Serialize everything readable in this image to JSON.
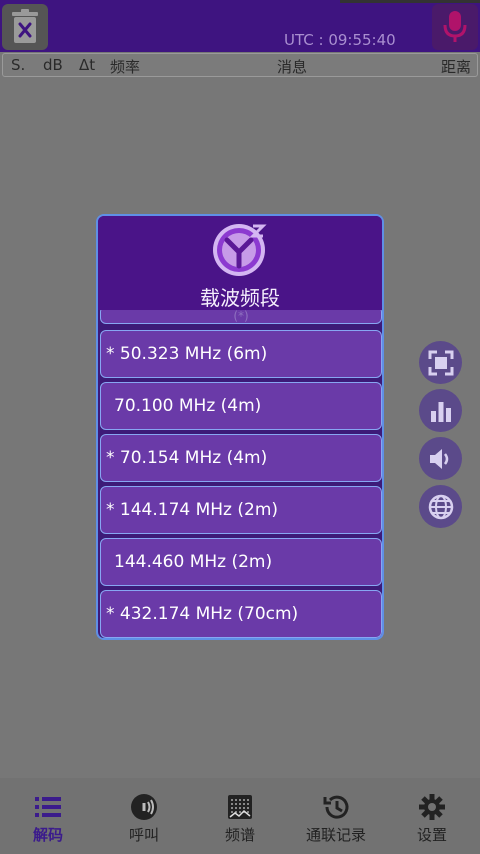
{
  "header": {
    "utc_text": "UTC : 09:55:40"
  },
  "columns": [
    "S.",
    "dB",
    "Δt",
    "频率",
    "消息",
    "距离"
  ],
  "dialog": {
    "title": "载波频段",
    "items": [
      "(*)",
      "* 50.323 MHz (6m)",
      "70.100 MHz (4m)",
      "* 70.154 MHz (4m)",
      "* 144.174 MHz (2m)",
      "144.460 MHz (2m)",
      "* 432.174 MHz (70cm)"
    ]
  },
  "side_buttons": [
    "fullscreen-icon",
    "bar-chart-icon",
    "volume-icon",
    "globe-icon"
  ],
  "bottom_nav": [
    {
      "label": "解码",
      "icon": "list-icon",
      "active": true
    },
    {
      "label": "呼叫",
      "icon": "broadcast-icon",
      "active": false
    },
    {
      "label": "频谱",
      "icon": "waterfall-icon",
      "active": false
    },
    {
      "label": "通联记录",
      "icon": "history-icon",
      "active": false
    },
    {
      "label": "设置",
      "icon": "gear-icon",
      "active": false
    }
  ],
  "colors": {
    "accent": "#3e1480",
    "dialog_item": "#6a3aa8",
    "item_border": "#87a6f2"
  }
}
